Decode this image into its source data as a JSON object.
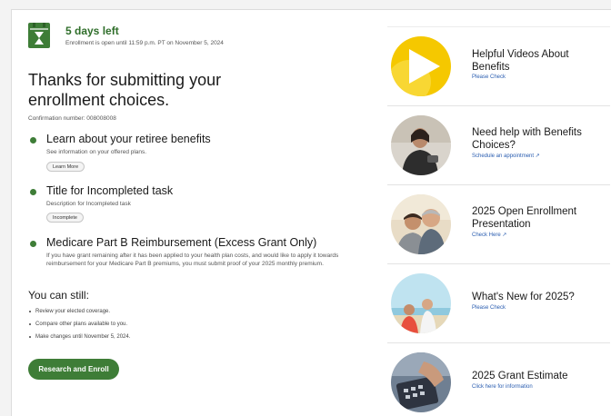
{
  "deadline": {
    "days_left": "5 days left",
    "note": "Enrollment is open until 11:59 p.m. PT on November 5, 2024"
  },
  "headline": "Thanks for submitting your enrollment choices.",
  "confirmation": "Confirmation number: 008008008",
  "tasks": [
    {
      "title": "Learn about your retiree benefits",
      "description": "See information on your offered plans.",
      "action": "Learn More"
    },
    {
      "title": "Title for Incompleted task",
      "description": "Description for Incompleted task",
      "action": "Incomplete"
    },
    {
      "title": "Medicare Part B Reimbursement (Excess Grant Only)",
      "description": "If you have grant remaining after it has been applied to your health plan costs, and would like to apply it towards reimbursement for your Medicare Part B premiums, you must submit proof of your 2025 monthly premium."
    }
  ],
  "you_can_still": {
    "title": "You can still:",
    "items": [
      "Review your elected coverage.",
      "Compare other plans available to you.",
      "Make changes until November 5, 2024."
    ]
  },
  "cta_label": "Research and Enroll",
  "cards": [
    {
      "title": "Helpful Videos About Benefits",
      "link": "Please Check",
      "external": ""
    },
    {
      "title": "Need help with Benefits Choices?",
      "link": "Schedule an appointment",
      "external": "↗"
    },
    {
      "title": "2025 Open Enrollment Presentation",
      "link": "Check Here",
      "external": "↗"
    },
    {
      "title": "What's New for 2025?",
      "link": "Please Check",
      "external": ""
    },
    {
      "title": "2025 Grant Estimate",
      "link": "Click here for information",
      "external": ""
    }
  ],
  "colors": {
    "brand_green": "#3e7d37",
    "link_blue": "#2a5db0"
  }
}
